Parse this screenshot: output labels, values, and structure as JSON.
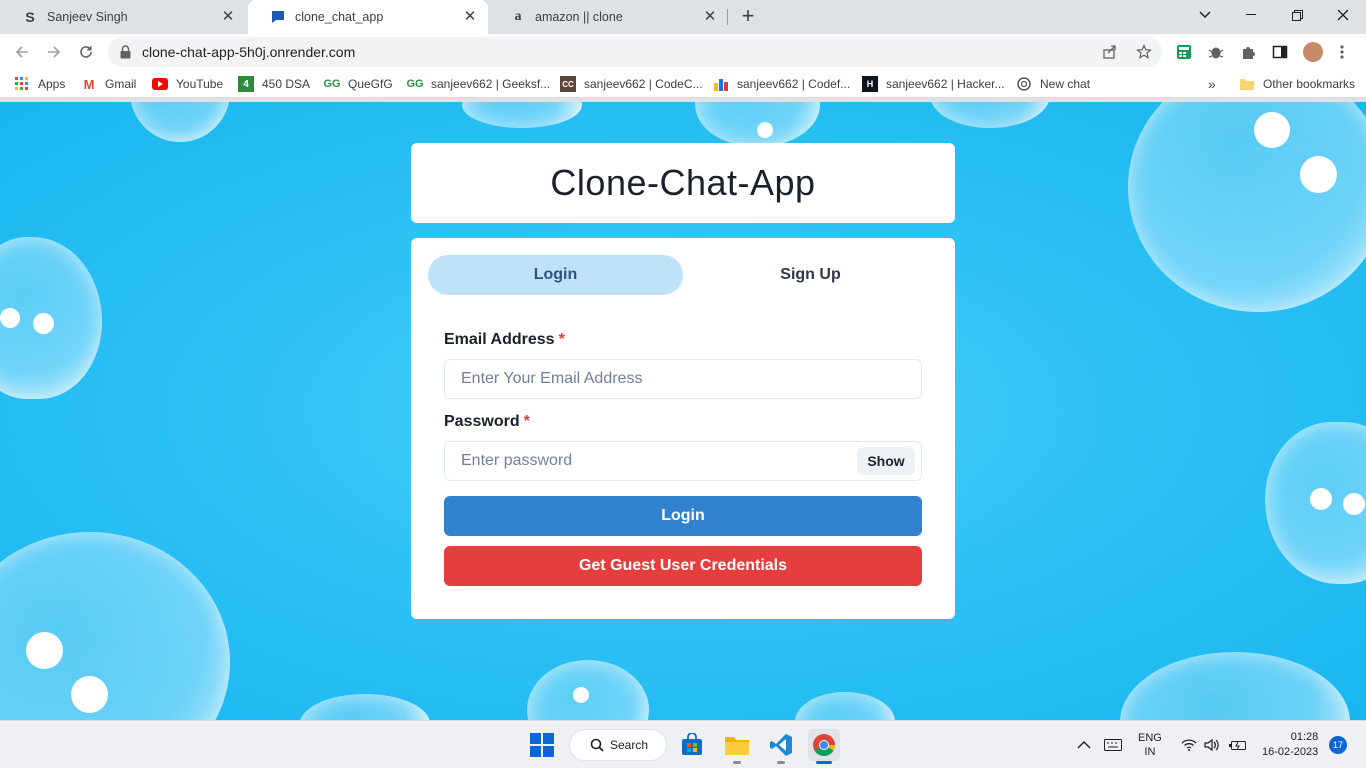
{
  "browser": {
    "tabs": [
      {
        "title": "Sanjeev Singh",
        "favicon": "s-letter-icon",
        "active": false
      },
      {
        "title": "clone_chat_app",
        "favicon": "chat-bubble-icon",
        "active": true
      },
      {
        "title": "amazon || clone",
        "favicon": "amazon-icon",
        "active": false
      }
    ],
    "url": "clone-chat-app-5h0j.onrender.com",
    "bookmarks": [
      {
        "label": "Apps"
      },
      {
        "label": "Gmail"
      },
      {
        "label": "YouTube"
      },
      {
        "label": "450 DSA"
      },
      {
        "label": "QueGfG"
      },
      {
        "label": "sanjeev662 | Geeksf..."
      },
      {
        "label": "sanjeev662 | CodeC..."
      },
      {
        "label": "sanjeev662 | Codef..."
      },
      {
        "label": "sanjeev662 | Hacker..."
      },
      {
        "label": "New chat"
      }
    ],
    "bookmarks_overflow": "»",
    "other_bookmarks": "Other bookmarks"
  },
  "app": {
    "title": "Clone-Chat-App",
    "tabs": {
      "login": "Login",
      "signup": "Sign Up",
      "selected": "login"
    },
    "email": {
      "label": "Email Address",
      "required_mark": "*",
      "placeholder": "Enter Your Email Address",
      "value": ""
    },
    "password": {
      "label": "Password",
      "required_mark": "*",
      "placeholder": "Enter password",
      "value": "",
      "toggle_label": "Show"
    },
    "login_button": "Login",
    "guest_button": "Get Guest User Credentials",
    "colors": {
      "primary": "#3182ce",
      "danger": "#e53e3e",
      "tab_selected": "#bee3f8",
      "background": "#2fc2f5"
    }
  },
  "taskbar": {
    "search_label": "Search",
    "language": "ENG",
    "region": "IN",
    "time": "01:28",
    "date": "16-02-2023",
    "notification_count": "17"
  }
}
